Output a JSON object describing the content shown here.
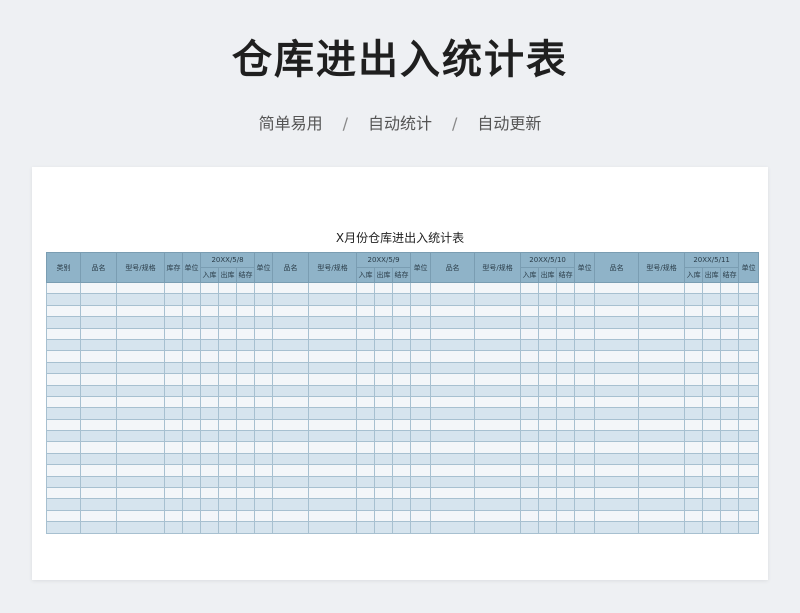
{
  "hero": {
    "title": "仓库进出入统计表",
    "features": [
      "简单易用",
      "自动统计",
      "自动更新"
    ],
    "separator": "/"
  },
  "sheet": {
    "title": "X月份仓库进出入统计表",
    "headers": {
      "category": "类别",
      "name": "品名",
      "model": "型号/规格",
      "stock": "库存",
      "unit": "单位",
      "in": "入库",
      "out": "出库",
      "balance": "结存"
    },
    "dates": [
      "20XX/5/8",
      "20XX/5/9",
      "20XX/5/10",
      "20XX/5/11"
    ]
  },
  "colors": {
    "header_bg": "#8fb3c8",
    "row_light": "#f3f6f9",
    "row_blue": "#d6e4ee",
    "page_bg": "#eef0f3"
  }
}
